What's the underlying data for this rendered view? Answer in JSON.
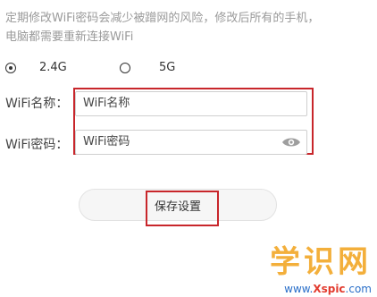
{
  "tip": {
    "line1": "定期修改WiFi密码会减少被蹭网的风险，修改后所有的手机，",
    "line2": "电脑都需要重新连接WiFi"
  },
  "band": {
    "options": [
      {
        "label": "2.4G",
        "selected": true
      },
      {
        "label": "5G",
        "selected": false
      }
    ]
  },
  "wifi_name": {
    "label": "WiFi名称：",
    "value": "WiFi名称"
  },
  "wifi_password": {
    "label": "WiFi密码：",
    "value": "WiFi密码",
    "toggle_icon": "eye-icon"
  },
  "save_button": {
    "label": "保存设置"
  },
  "watermark": {
    "logo": "学识网",
    "url_prefix": "www.",
    "url_brand": "Xspic",
    "url_suffix": ".com"
  },
  "colors": {
    "highlight": "#c8262b",
    "watermark": "#f2a21a",
    "url": "#2a6fc9"
  }
}
